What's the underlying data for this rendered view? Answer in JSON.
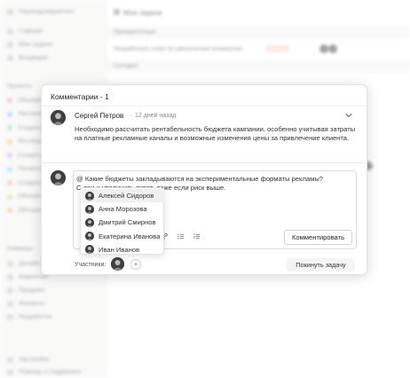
{
  "background": {
    "sidebar": {
      "title": "Переход маркетинг",
      "items": [
        "Главная",
        "Мои задачи",
        "Входящие"
      ],
      "projects_header": "Проекты",
      "projects": [
        "Обновить",
        "Настроить",
        "Создать",
        "Исследовать",
        "Создать",
        "Провести",
        "Создать",
        "Обновить",
        "Обновить"
      ],
      "teams_header": "Команды",
      "teams": [
        "Дизайн",
        "Маркетинг",
        "Продажи",
        "Финансы",
        "Разработка"
      ],
      "footer": [
        "Настройки",
        "Помощь и поддержка"
      ],
      "project_colors": [
        "#e7a0c9",
        "#a5b4f0",
        "#9fd8b8",
        "#f0c27b",
        "#c9a5f0",
        "#8fd3e8",
        "#f0a5a5",
        "#b5e08f",
        "#e0c08f"
      ]
    },
    "main": {
      "title": "Мои задачи",
      "sections": [
        "Приоритетные",
        "Сегодня"
      ],
      "task": "Разработать план по увеличению конверсии",
      "badge": "2 дня"
    }
  },
  "modal": {
    "title": "Комментарии - 1",
    "comment": {
      "author": "Сергей Петров",
      "separator": "·",
      "time": "12 дней назад",
      "text": "Необходимо рассчитать рентабельность бюджета кампании, особенно учитывая затраты на платные рекламные каналы и возможные изменения цены за привлечение клиента."
    },
    "editor": {
      "line1": "@ Какие бюджеты закладываются на экспериментальные форматы рекламы?",
      "line2": "С                                 деи и увеличить охват, даже если риск выше."
    },
    "mention_list": [
      {
        "name": "Алексей Сидоров",
        "active": true
      },
      {
        "name": "Анна Морозова",
        "active": false
      },
      {
        "name": "Дмитрий Смирнов",
        "active": false
      },
      {
        "name": "Екатерина Иванова",
        "active": false
      },
      {
        "name": "Иван Иванов",
        "active": false
      }
    ],
    "toolbar_icons": [
      "link-icon",
      "bullet-list-icon",
      "numbered-list-icon"
    ],
    "comment_button": "Комментировать",
    "participants_label": "Участники:",
    "add_participant": "+",
    "leave_button": "Покинуть задачу"
  }
}
